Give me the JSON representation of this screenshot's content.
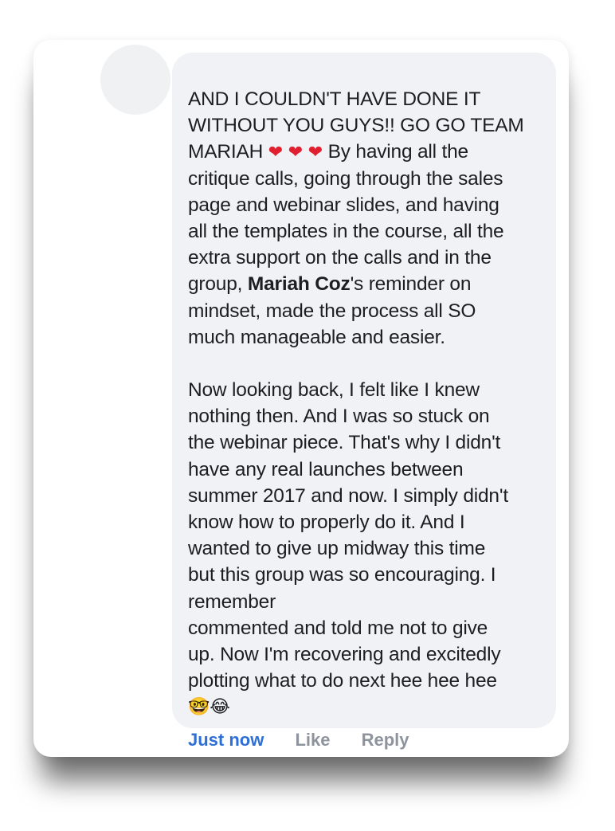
{
  "comment": {
    "lines": [
      "AND I COULDN'T HAVE DONE IT",
      "WITHOUT YOU GUYS!! GO GO TEAM",
      "critique calls, going through the sales",
      "page and webinar slides, and having",
      "all the templates in the course, all the",
      "extra support on the calls and in the",
      "mindset, made the process all SO",
      "much manageable and easier.",
      "Now looking back, I felt like I knew",
      "nothing then. And I was so stuck on",
      "the webinar piece. That's why I didn't",
      "have any real launches between",
      "summer 2017 and now. I simply didn't",
      "know how to properly do it. And I",
      "wanted to give up midway this time",
      "but this group was so encouraging. I",
      "remember",
      "commented and told me not to give",
      "up. Now I'm recovering and excitedly",
      "plotting what to do next hee hee hee"
    ],
    "line3_start": "MARIAH ",
    "hearts": "❤ ❤ ❤",
    "line3_end": " By having all the",
    "line9_start": "group, ",
    "mention": "Mariah Coz",
    "line9_end": "'s reminder on",
    "end_emojis": "🤓😂"
  },
  "actions": {
    "timestamp": "Just now",
    "like": "Like",
    "reply": "Reply"
  },
  "colors": {
    "bubble": "#f0f2f5",
    "timestamp": "#2d6fd6",
    "action": "#8d949e",
    "heart": "#e0202e"
  },
  "icons": {
    "hearts": "red-heart-icon",
    "end": [
      "nerd-face-icon",
      "tears-of-joy-icon"
    ]
  }
}
